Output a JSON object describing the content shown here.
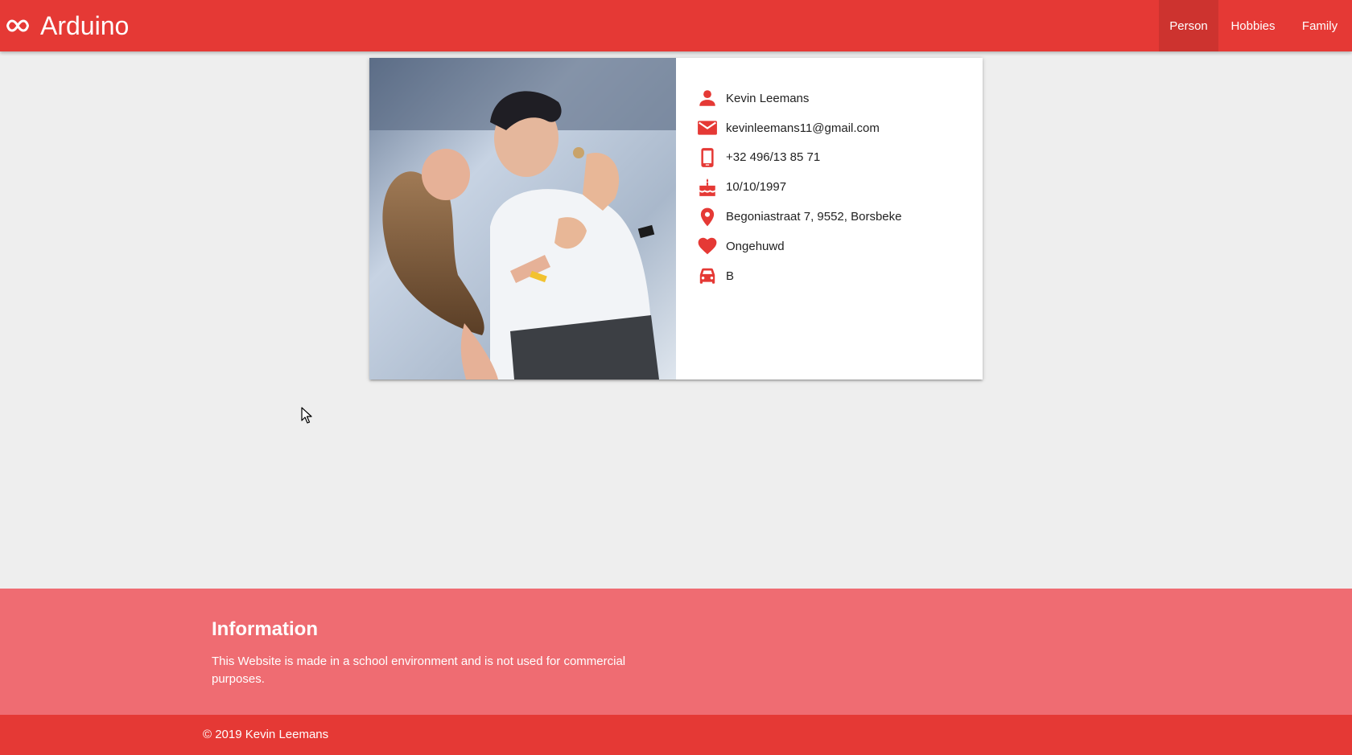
{
  "brand": {
    "title": "Arduino",
    "icon": "infinity-icon"
  },
  "nav": {
    "items": [
      {
        "label": "Person",
        "active": true
      },
      {
        "label": "Hobbies",
        "active": false
      },
      {
        "label": "Family",
        "active": false
      }
    ]
  },
  "profile": {
    "name": "Kevin Leemans",
    "email": "kevinleemans11@gmail.com",
    "phone": "+32 496/13 85 71",
    "birthday": "10/10/1997",
    "address": "Begoniastraat 7, 9552, Borsbeke",
    "relationship": "Ongehuwd",
    "license": "B"
  },
  "footer": {
    "title": "Information",
    "text": "This Website is made in a school environment and is not used for commercial purposes.",
    "copyright": "© 2019 Kevin Leemans"
  },
  "colors": {
    "primary": "#e53935",
    "footer": "#ef6c72",
    "background": "#eeeeee"
  }
}
